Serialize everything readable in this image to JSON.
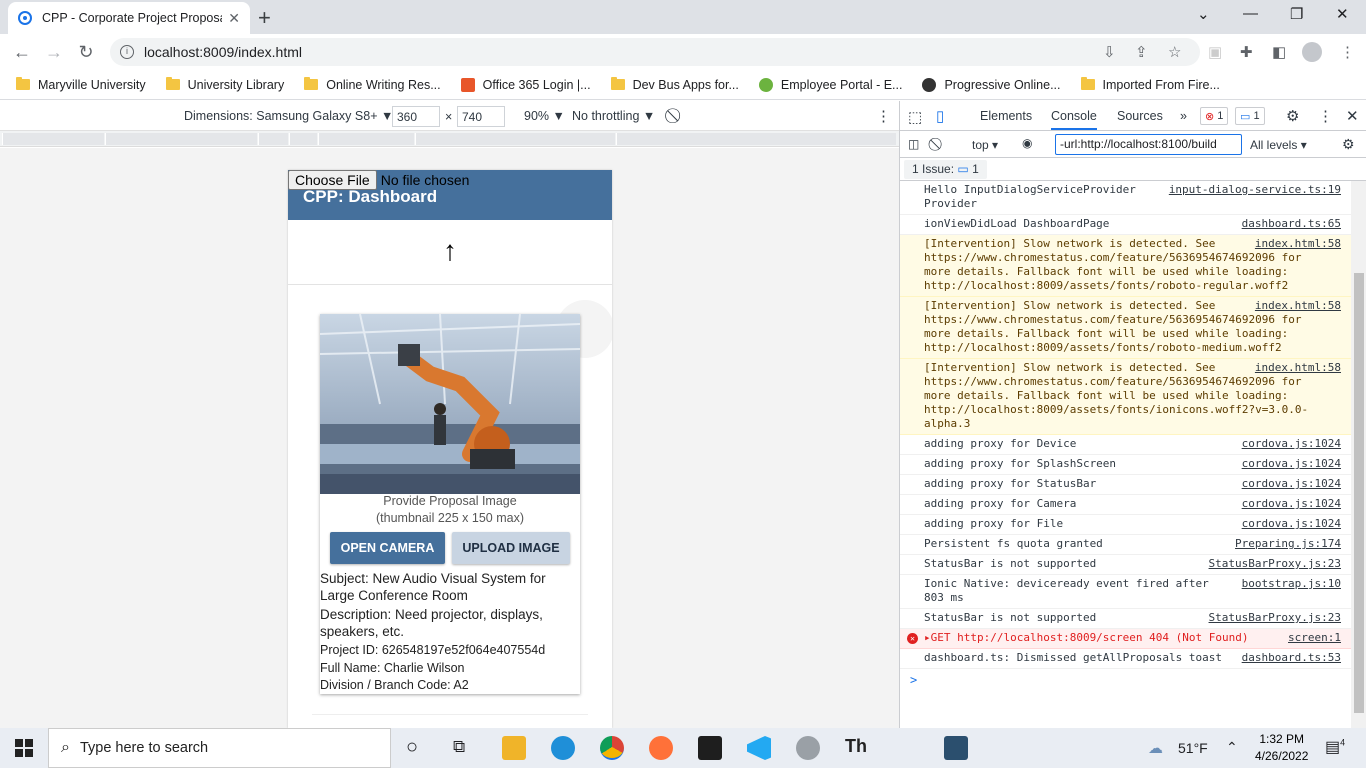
{
  "browser": {
    "tab_title": "CPP - Corporate Project Proposal",
    "url": "localhost:8009/index.html",
    "bookmarks": [
      "Maryville University",
      "University Library",
      "Online Writing Res...",
      "Office 365 Login |...",
      "Dev Bus Apps for...",
      "Employee Portal - E...",
      "Progressive Online...",
      "Imported From Fire..."
    ]
  },
  "device_toolbar": {
    "dimensions": "Dimensions: Samsung Galaxy S8+",
    "width": "360",
    "height": "740",
    "zoom": "90%",
    "throttle": "No throttling"
  },
  "app": {
    "file_button": "Choose File",
    "file_status": "No file chosen",
    "header_title": "CPP: Dashboard",
    "up_arrow": "↑",
    "image_caption_1": "Provide Proposal Image",
    "image_caption_2": "(thumbnail 225 x 150 max)",
    "open_camera": "OPEN CAMERA",
    "upload_image": "UPLOAD IMAGE",
    "subject": "Subject: New Audio Visual System for Large Conference Room",
    "description": "Description: Need projector, displays, speakers, etc.",
    "project_id": "Project ID: 626548197e52f064e407554d",
    "full_name": "Full Name: Charlie Wilson",
    "division": "Division / Branch Code: A2"
  },
  "devtools": {
    "tabs": [
      "Elements",
      "Console",
      "Sources"
    ],
    "active_tab": "Console",
    "error_count": "1",
    "info_count": "1",
    "context": "top",
    "filter": "-url:http://localhost:8100/build",
    "levels": "All levels",
    "issues": "1 Issue:",
    "issues_count": "1",
    "messages": [
      {
        "type": "log",
        "text": "Hello InputDialogServiceProvider Provider",
        "src": "input-dialog-service.ts:19"
      },
      {
        "type": "log",
        "text": "ionViewDidLoad DashboardPage",
        "src": "dashboard.ts:65"
      },
      {
        "type": "warn",
        "text": "[Intervention] Slow network is detected. See https://www.chromestatus.com/feature/5636954674692096 for more details. Fallback font will be used while loading: http://localhost:8009/assets/fonts/roboto-regular.woff2",
        "src": "index.html:58"
      },
      {
        "type": "warn",
        "text": "[Intervention] Slow network is detected. See https://www.chromestatus.com/feature/5636954674692096 for more details. Fallback font will be used while loading: http://localhost:8009/assets/fonts/roboto-medium.woff2",
        "src": "index.html:58"
      },
      {
        "type": "warn",
        "text": "[Intervention] Slow network is detected. See https://www.chromestatus.com/feature/5636954674692096 for more details. Fallback font will be used while loading: http://localhost:8009/assets/fonts/ionicons.woff2?v=3.0.0-alpha.3",
        "src": "index.html:58"
      },
      {
        "type": "log",
        "text": "adding proxy for Device",
        "src": "cordova.js:1024"
      },
      {
        "type": "log",
        "text": "adding proxy for SplashScreen",
        "src": "cordova.js:1024"
      },
      {
        "type": "log",
        "text": "adding proxy for StatusBar",
        "src": "cordova.js:1024"
      },
      {
        "type": "log",
        "text": "adding proxy for Camera",
        "src": "cordova.js:1024"
      },
      {
        "type": "log",
        "text": "adding proxy for File",
        "src": "cordova.js:1024"
      },
      {
        "type": "log",
        "text": "Persistent fs quota granted",
        "src": "Preparing.js:174"
      },
      {
        "type": "log",
        "text": "StatusBar is not supported",
        "src": "StatusBarProxy.js:23"
      },
      {
        "type": "log",
        "text": "Ionic Native: deviceready event fired after 803 ms",
        "src": "bootstrap.js:10"
      },
      {
        "type": "log",
        "text": "StatusBar is not supported",
        "src": "StatusBarProxy.js:23"
      },
      {
        "type": "error",
        "text": "▸GET http://localhost:8009/screen 404 (Not Found)",
        "src": "screen:1"
      },
      {
        "type": "log",
        "text": "dashboard.ts: Dismissed getAllProposals toast",
        "src": "dashboard.ts:53"
      }
    ],
    "prompt": ">"
  },
  "taskbar": {
    "search_placeholder": "Type here to search",
    "weather": "51°F",
    "time": "1:32 PM",
    "date": "4/26/2022",
    "notifications": "4"
  },
  "colors": {
    "header_blue": "#45709c",
    "upload_btn": "#c8d4e2",
    "warn_bg": "#fffbe5",
    "error_bg": "#fff0f0"
  }
}
